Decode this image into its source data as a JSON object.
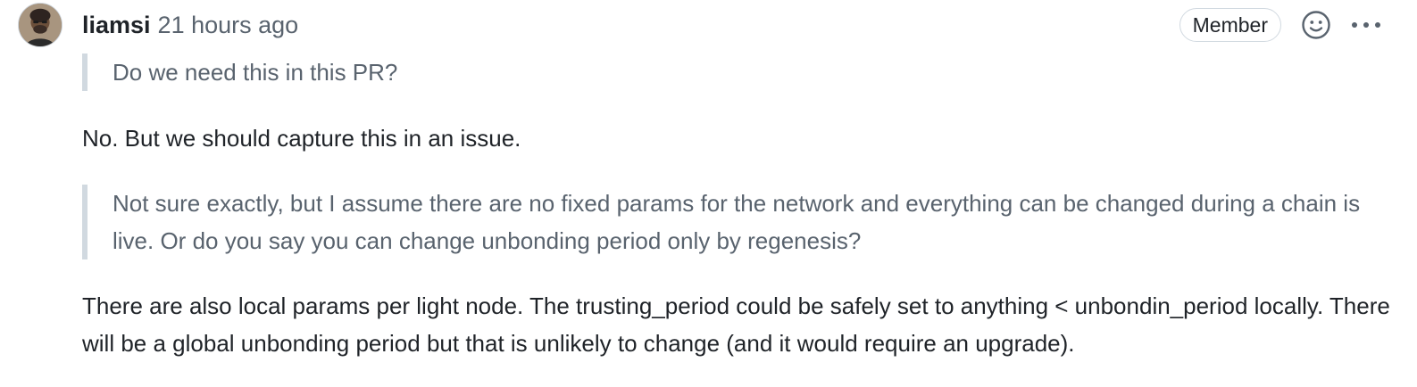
{
  "comment": {
    "author": "liamsi",
    "timestamp": "21 hours ago",
    "role_badge": "Member",
    "icons": {
      "avatar": "user-avatar",
      "reaction": "smiley-icon",
      "menu": "kebab-horizontal-icon"
    },
    "body": {
      "quote_1": "Do we need this in this PR?",
      "paragraph_1": "No. But we should capture this in an issue.",
      "quote_2": "Not sure exactly, but I assume there are no fixed params for the network and everything can be changed during a chain is live. Or do you say you can change unbonding period only by regenesis?",
      "paragraph_2": "There are also local params per light node. The trusting_period could be safely set to anything < unbondin_period locally. There will be a global unbonding period but that is unlikely to change (and it would require an upgrade)."
    }
  }
}
